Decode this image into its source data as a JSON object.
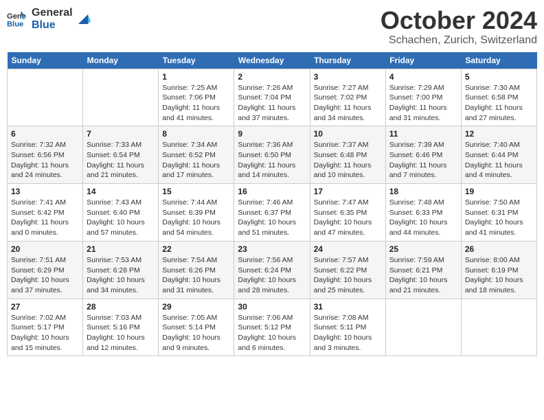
{
  "header": {
    "logo_line1": "General",
    "logo_line2": "Blue",
    "month": "October 2024",
    "location": "Schachen, Zurich, Switzerland"
  },
  "days_of_week": [
    "Sunday",
    "Monday",
    "Tuesday",
    "Wednesday",
    "Thursday",
    "Friday",
    "Saturday"
  ],
  "weeks": [
    [
      {
        "num": "",
        "sunrise": "",
        "sunset": "",
        "daylight": ""
      },
      {
        "num": "",
        "sunrise": "",
        "sunset": "",
        "daylight": ""
      },
      {
        "num": "1",
        "sunrise": "Sunrise: 7:25 AM",
        "sunset": "Sunset: 7:06 PM",
        "daylight": "Daylight: 11 hours and 41 minutes."
      },
      {
        "num": "2",
        "sunrise": "Sunrise: 7:26 AM",
        "sunset": "Sunset: 7:04 PM",
        "daylight": "Daylight: 11 hours and 37 minutes."
      },
      {
        "num": "3",
        "sunrise": "Sunrise: 7:27 AM",
        "sunset": "Sunset: 7:02 PM",
        "daylight": "Daylight: 11 hours and 34 minutes."
      },
      {
        "num": "4",
        "sunrise": "Sunrise: 7:29 AM",
        "sunset": "Sunset: 7:00 PM",
        "daylight": "Daylight: 11 hours and 31 minutes."
      },
      {
        "num": "5",
        "sunrise": "Sunrise: 7:30 AM",
        "sunset": "Sunset: 6:58 PM",
        "daylight": "Daylight: 11 hours and 27 minutes."
      }
    ],
    [
      {
        "num": "6",
        "sunrise": "Sunrise: 7:32 AM",
        "sunset": "Sunset: 6:56 PM",
        "daylight": "Daylight: 11 hours and 24 minutes."
      },
      {
        "num": "7",
        "sunrise": "Sunrise: 7:33 AM",
        "sunset": "Sunset: 6:54 PM",
        "daylight": "Daylight: 11 hours and 21 minutes."
      },
      {
        "num": "8",
        "sunrise": "Sunrise: 7:34 AM",
        "sunset": "Sunset: 6:52 PM",
        "daylight": "Daylight: 11 hours and 17 minutes."
      },
      {
        "num": "9",
        "sunrise": "Sunrise: 7:36 AM",
        "sunset": "Sunset: 6:50 PM",
        "daylight": "Daylight: 11 hours and 14 minutes."
      },
      {
        "num": "10",
        "sunrise": "Sunrise: 7:37 AM",
        "sunset": "Sunset: 6:48 PM",
        "daylight": "Daylight: 11 hours and 10 minutes."
      },
      {
        "num": "11",
        "sunrise": "Sunrise: 7:39 AM",
        "sunset": "Sunset: 6:46 PM",
        "daylight": "Daylight: 11 hours and 7 minutes."
      },
      {
        "num": "12",
        "sunrise": "Sunrise: 7:40 AM",
        "sunset": "Sunset: 6:44 PM",
        "daylight": "Daylight: 11 hours and 4 minutes."
      }
    ],
    [
      {
        "num": "13",
        "sunrise": "Sunrise: 7:41 AM",
        "sunset": "Sunset: 6:42 PM",
        "daylight": "Daylight: 11 hours and 0 minutes."
      },
      {
        "num": "14",
        "sunrise": "Sunrise: 7:43 AM",
        "sunset": "Sunset: 6:40 PM",
        "daylight": "Daylight: 10 hours and 57 minutes."
      },
      {
        "num": "15",
        "sunrise": "Sunrise: 7:44 AM",
        "sunset": "Sunset: 6:39 PM",
        "daylight": "Daylight: 10 hours and 54 minutes."
      },
      {
        "num": "16",
        "sunrise": "Sunrise: 7:46 AM",
        "sunset": "Sunset: 6:37 PM",
        "daylight": "Daylight: 10 hours and 51 minutes."
      },
      {
        "num": "17",
        "sunrise": "Sunrise: 7:47 AM",
        "sunset": "Sunset: 6:35 PM",
        "daylight": "Daylight: 10 hours and 47 minutes."
      },
      {
        "num": "18",
        "sunrise": "Sunrise: 7:48 AM",
        "sunset": "Sunset: 6:33 PM",
        "daylight": "Daylight: 10 hours and 44 minutes."
      },
      {
        "num": "19",
        "sunrise": "Sunrise: 7:50 AM",
        "sunset": "Sunset: 6:31 PM",
        "daylight": "Daylight: 10 hours and 41 minutes."
      }
    ],
    [
      {
        "num": "20",
        "sunrise": "Sunrise: 7:51 AM",
        "sunset": "Sunset: 6:29 PM",
        "daylight": "Daylight: 10 hours and 37 minutes."
      },
      {
        "num": "21",
        "sunrise": "Sunrise: 7:53 AM",
        "sunset": "Sunset: 6:28 PM",
        "daylight": "Daylight: 10 hours and 34 minutes."
      },
      {
        "num": "22",
        "sunrise": "Sunrise: 7:54 AM",
        "sunset": "Sunset: 6:26 PM",
        "daylight": "Daylight: 10 hours and 31 minutes."
      },
      {
        "num": "23",
        "sunrise": "Sunrise: 7:56 AM",
        "sunset": "Sunset: 6:24 PM",
        "daylight": "Daylight: 10 hours and 28 minutes."
      },
      {
        "num": "24",
        "sunrise": "Sunrise: 7:57 AM",
        "sunset": "Sunset: 6:22 PM",
        "daylight": "Daylight: 10 hours and 25 minutes."
      },
      {
        "num": "25",
        "sunrise": "Sunrise: 7:59 AM",
        "sunset": "Sunset: 6:21 PM",
        "daylight": "Daylight: 10 hours and 21 minutes."
      },
      {
        "num": "26",
        "sunrise": "Sunrise: 8:00 AM",
        "sunset": "Sunset: 6:19 PM",
        "daylight": "Daylight: 10 hours and 18 minutes."
      }
    ],
    [
      {
        "num": "27",
        "sunrise": "Sunrise: 7:02 AM",
        "sunset": "Sunset: 5:17 PM",
        "daylight": "Daylight: 10 hours and 15 minutes."
      },
      {
        "num": "28",
        "sunrise": "Sunrise: 7:03 AM",
        "sunset": "Sunset: 5:16 PM",
        "daylight": "Daylight: 10 hours and 12 minutes."
      },
      {
        "num": "29",
        "sunrise": "Sunrise: 7:05 AM",
        "sunset": "Sunset: 5:14 PM",
        "daylight": "Daylight: 10 hours and 9 minutes."
      },
      {
        "num": "30",
        "sunrise": "Sunrise: 7:06 AM",
        "sunset": "Sunset: 5:12 PM",
        "daylight": "Daylight: 10 hours and 6 minutes."
      },
      {
        "num": "31",
        "sunrise": "Sunrise: 7:08 AM",
        "sunset": "Sunset: 5:11 PM",
        "daylight": "Daylight: 10 hours and 3 minutes."
      },
      {
        "num": "",
        "sunrise": "",
        "sunset": "",
        "daylight": ""
      },
      {
        "num": "",
        "sunrise": "",
        "sunset": "",
        "daylight": ""
      }
    ]
  ]
}
